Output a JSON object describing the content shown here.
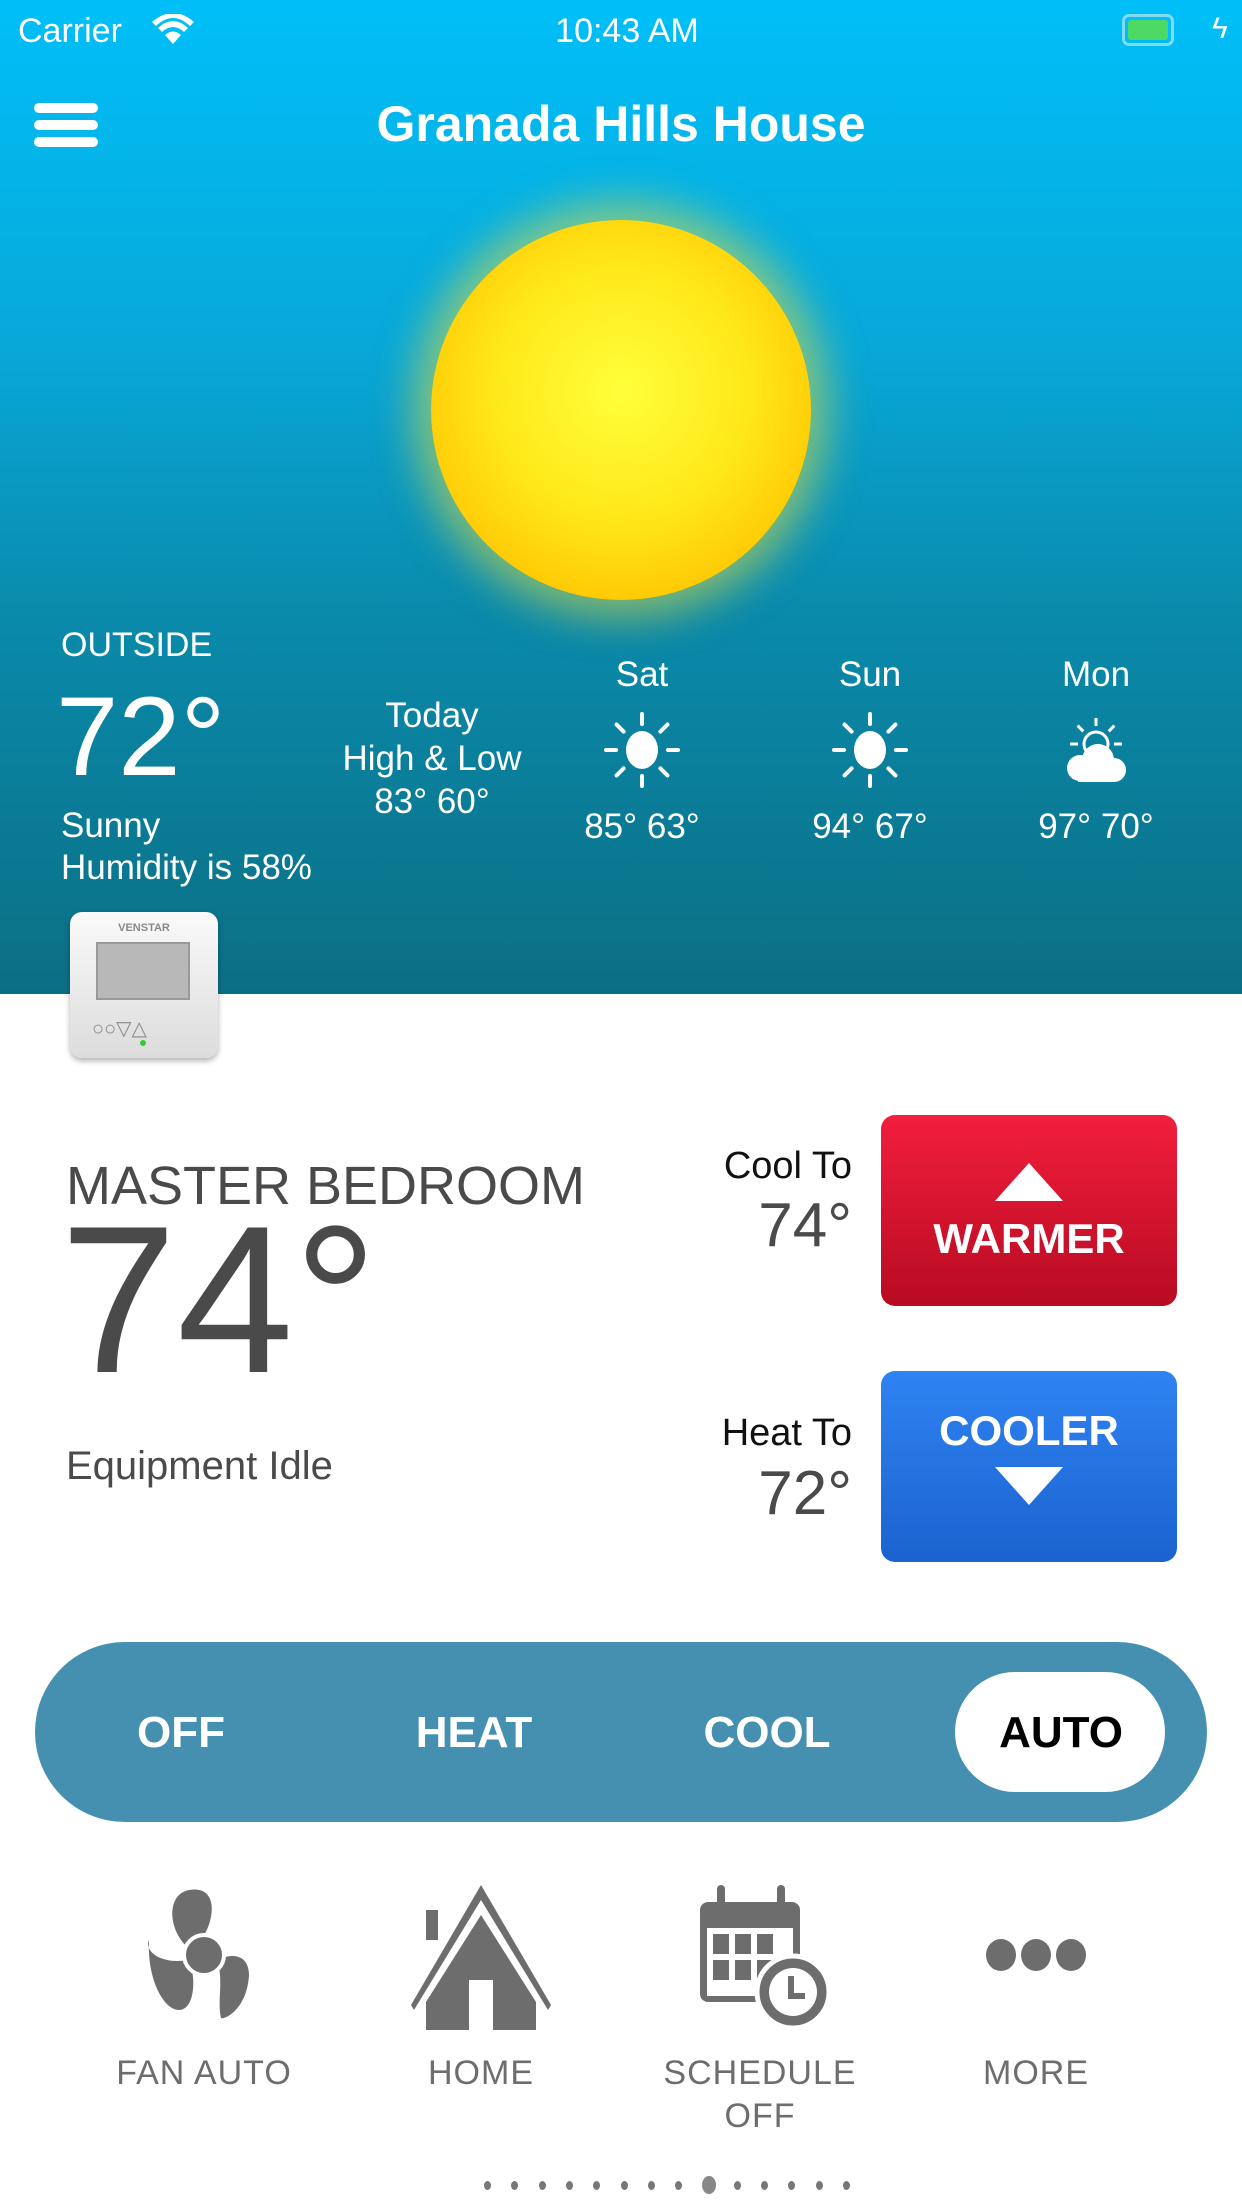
{
  "status_bar": {
    "carrier": "Carrier",
    "time": "10:43 AM",
    "battery_color": "#4cd964"
  },
  "header": {
    "title": "Granada Hills House",
    "menu_icon": "hamburger-icon"
  },
  "weather": {
    "current_icon": "sun",
    "outside_label": "OUTSIDE",
    "outside_temp": "72°",
    "condition": "Sunny",
    "humidity": "Humidity is 58%",
    "today": {
      "line1": "Today",
      "line2": "High & Low",
      "temps": "83° 60°"
    },
    "forecast": [
      {
        "day": "Sat",
        "icon": "sunny-icon",
        "temps": "85° 63°"
      },
      {
        "day": "Sun",
        "icon": "sunny-icon",
        "temps": "94° 67°"
      },
      {
        "day": "Mon",
        "icon": "partly-cloudy-icon",
        "temps": "97° 70°"
      }
    ]
  },
  "thermostat": {
    "brand": "VENSTAR",
    "room": "MASTER BEDROOM",
    "temp": "74°",
    "status": "Equipment Idle",
    "cool_to_label": "Cool To",
    "cool_to": "74°",
    "heat_to_label": "Heat To",
    "heat_to": "72°",
    "warmer_label": "WARMER",
    "cooler_label": "COOLER",
    "warmer_color": "#d0142c",
    "cooler_color": "#2476e0"
  },
  "modes": {
    "items": [
      "OFF",
      "HEAT",
      "COOL",
      "AUTO"
    ],
    "selected": "AUTO",
    "bar_color": "#4590b0"
  },
  "toolbar": [
    {
      "label": "FAN AUTO",
      "icon": "fan-icon"
    },
    {
      "label": "HOME",
      "icon": "home-icon"
    },
    {
      "label": "SCHEDULE",
      "label2": "OFF",
      "icon": "schedule-icon"
    },
    {
      "label": "MORE",
      "icon": "more-icon"
    }
  ],
  "pager": {
    "count": 14,
    "active_index": 8
  }
}
